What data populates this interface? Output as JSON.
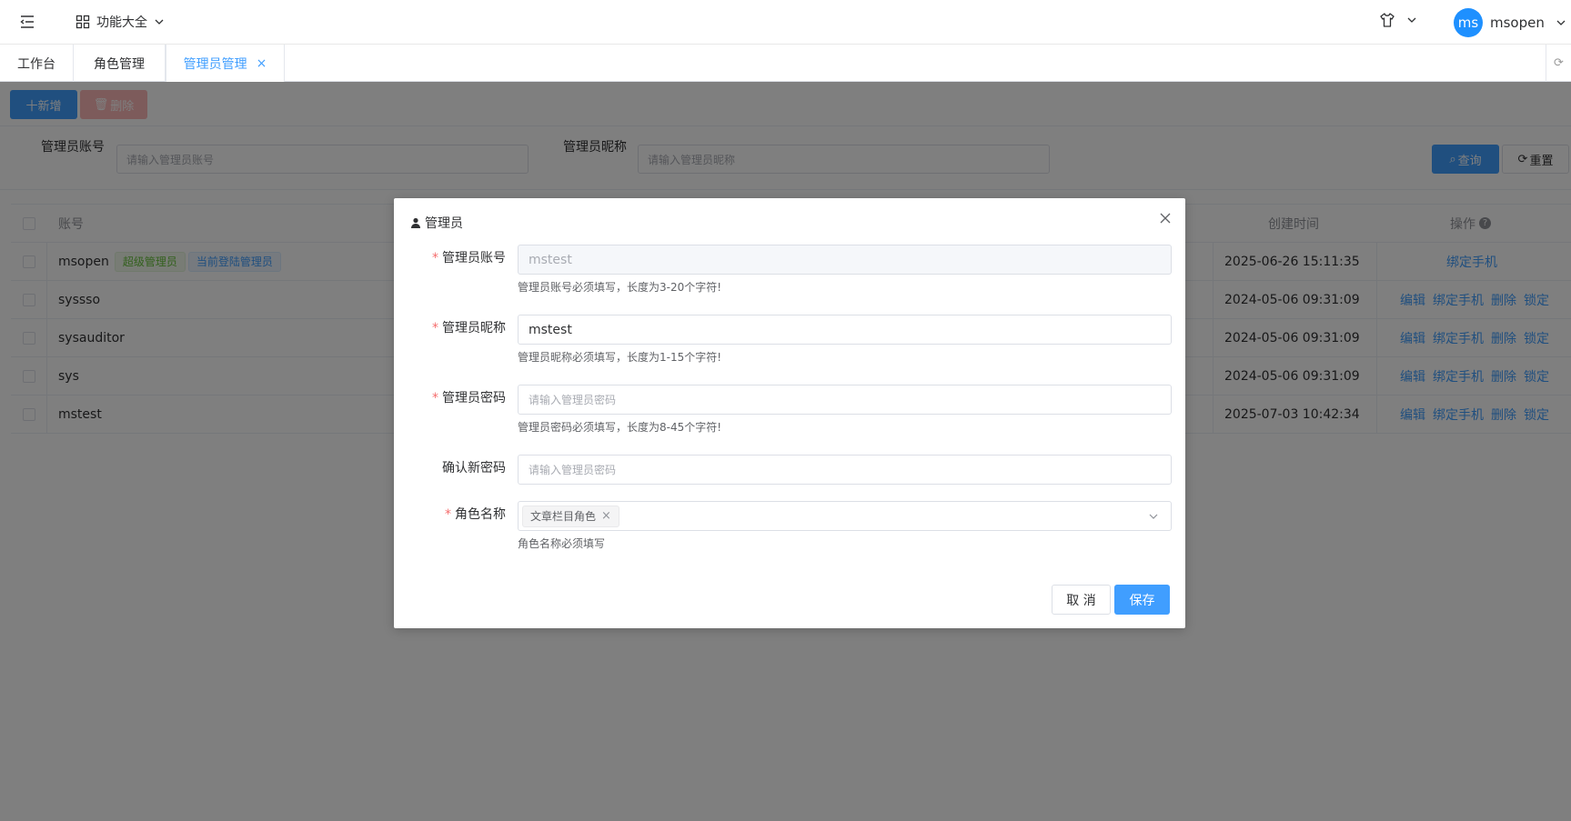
{
  "header": {
    "menu_label": "功能大全",
    "user_avatar_text": "ms",
    "user_name": "msopen"
  },
  "tabs": [
    {
      "label": "工作台"
    },
    {
      "label": "角色管理"
    },
    {
      "label": "管理员管理",
      "active": true
    }
  ],
  "toolbar": {
    "add_label": "十新增",
    "delete_label": "删除"
  },
  "search": {
    "account_label": "管理员账号",
    "account_placeholder": "请输入管理员账号",
    "nickname_label": "管理员昵称",
    "nickname_placeholder": "请输入管理员昵称",
    "query_label": "查询",
    "reset_label": "重置"
  },
  "table": {
    "headers": {
      "account": "账号",
      "created": "创建时间",
      "actions": "操作"
    },
    "rows": [
      {
        "account": "msopen",
        "tags": [
          "超级管理员",
          "当前登陆管理员"
        ],
        "created": "2025-06-26 15:11:35",
        "actions": [
          "绑定手机"
        ]
      },
      {
        "account": "syssso",
        "tags": [],
        "created": "2024-05-06 09:31:09",
        "actions": [
          "编辑",
          "绑定手机",
          "删除",
          "锁定"
        ]
      },
      {
        "account": "sysauditor",
        "tags": [],
        "created": "2024-05-06 09:31:09",
        "actions": [
          "编辑",
          "绑定手机",
          "删除",
          "锁定"
        ]
      },
      {
        "account": "sys",
        "tags": [],
        "created": "2024-05-06 09:31:09",
        "actions": [
          "编辑",
          "绑定手机",
          "删除",
          "锁定"
        ]
      },
      {
        "account": "mstest",
        "tags": [],
        "created": "2025-07-03 10:42:34",
        "actions": [
          "编辑",
          "绑定手机",
          "删除",
          "锁定"
        ]
      }
    ]
  },
  "dialog": {
    "title": "管理员",
    "account_label": "管理员账号",
    "account_value": "mstest",
    "account_hint": "管理员账号必须填写，长度为3-20个字符!",
    "nickname_label": "管理员昵称",
    "nickname_value": "mstest",
    "nickname_hint": "管理员昵称必须填写，长度为1-15个字符!",
    "password_label": "管理员密码",
    "password_placeholder": "请输入管理员密码",
    "password_hint": "管理员密码必须填写，长度为8-45个字符!",
    "confirm_label": "确认新密码",
    "confirm_placeholder": "请输入管理员密码",
    "role_label": "角色名称",
    "role_selected": "文章栏目角色",
    "role_hint": "角色名称必须填写",
    "cancel_label": "取 消",
    "save_label": "保存"
  },
  "colors": {
    "primary": "#409eff",
    "danger_disabled": "#fab6b6",
    "required": "#f56c6c"
  }
}
